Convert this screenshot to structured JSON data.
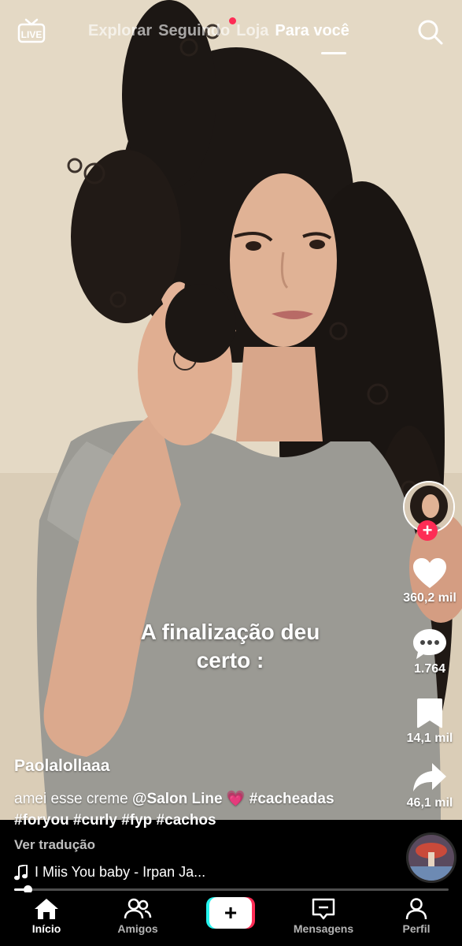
{
  "top_nav": {
    "live_label": "LIVE",
    "tabs": [
      "Explorar",
      "Seguindo",
      "Loja",
      "Para você"
    ],
    "active_tab": "Para você",
    "notification_dot_on": "Seguindo",
    "search_icon": "search-icon"
  },
  "video": {
    "caption_line1": "A finalização deu",
    "caption_line2": "certo :"
  },
  "right_rail": {
    "likes": "360,2 mil",
    "comments": "1.764",
    "saves": "14,1 mil",
    "shares": "46,1 mil",
    "follow_symbol": "+"
  },
  "post": {
    "author": "Paolalollaaa",
    "desc_text": "amei esse creme",
    "mention": "@Salon Line",
    "emoji": "💗",
    "hashtag1": "#cacheadas",
    "hashtags_line2": "#foryou #curly #fyp #cachos",
    "translate_label": "Ver tradução",
    "music_title": "I Miis You baby - Irpan Ja..."
  },
  "progress": {
    "fraction": 0.03
  },
  "bottom_nav": {
    "home": "Início",
    "friends": "Amigos",
    "create_symbol": "+",
    "inbox": "Mensagens",
    "profile": "Perfil"
  },
  "colors": {
    "accent_pink": "#fe2c55",
    "accent_cyan": "#25f4ee",
    "background": "#000000"
  }
}
